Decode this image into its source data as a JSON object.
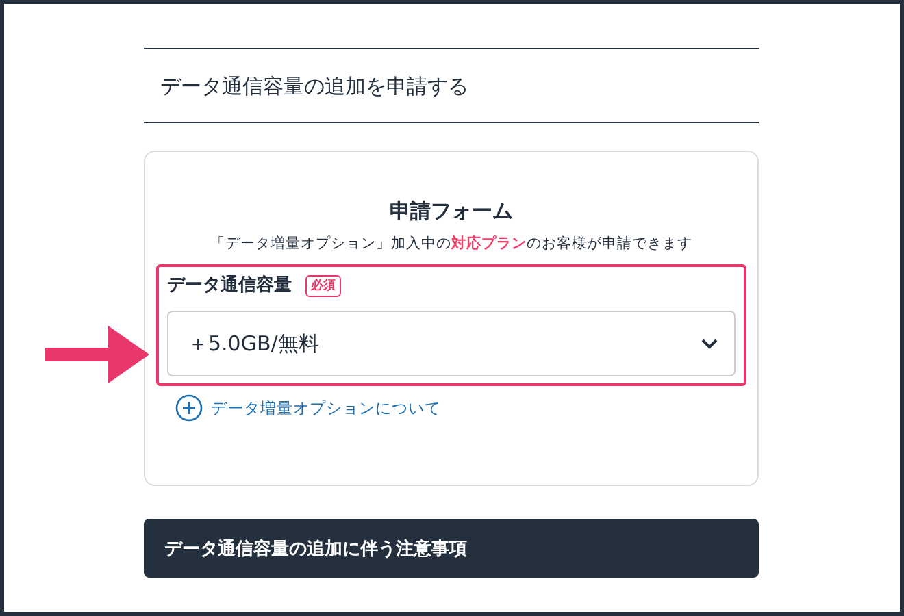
{
  "page_heading": "データ通信容量の追加を申請する",
  "form": {
    "title": "申請フォーム",
    "note": "「データ増量オプション」加入中の**対応プラン**のお客様が申請できます",
    "field": {
      "label": "データ通信容量",
      "badge": "必須",
      "highlighted": true,
      "value": "＋5.0GB/無料"
    },
    "link": "データ増量オプションについて"
  },
  "notice_bar": "データ通信容量の追加に伴う注意事項"
}
